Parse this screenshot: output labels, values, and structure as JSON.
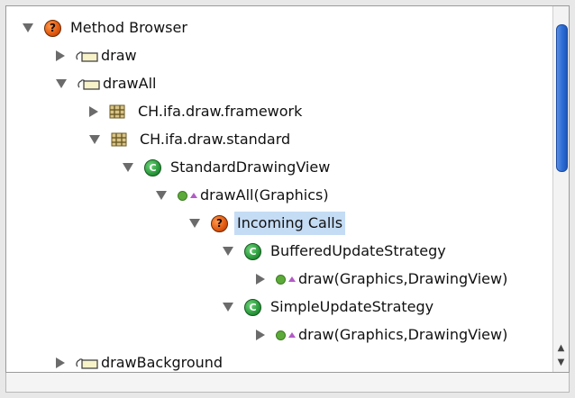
{
  "tree": {
    "root": {
      "label": "Method Browser",
      "icon": "question-icon"
    },
    "n_draw": {
      "label": "draw",
      "icon": "method-selector-icon"
    },
    "n_drawAll": {
      "label": "drawAll",
      "icon": "method-selector-icon"
    },
    "n_pkg_framework": {
      "label": "CH.ifa.draw.framework",
      "icon": "package-icon"
    },
    "n_pkg_standard": {
      "label": "CH.ifa.draw.standard",
      "icon": "package-icon"
    },
    "n_class_sdv": {
      "label": "StandardDrawingView",
      "icon": "class-icon",
      "glyph": "C"
    },
    "n_method_drawAll": {
      "label": "drawAll(Graphics)",
      "icon": "method-icon"
    },
    "n_incoming": {
      "label": "Incoming Calls",
      "icon": "question-icon",
      "glyph": "?"
    },
    "n_class_bus": {
      "label": "BufferedUpdateStrategy",
      "icon": "class-icon",
      "glyph": "C"
    },
    "n_method_draw1": {
      "label": "draw(Graphics,DrawingView)",
      "icon": "method-icon"
    },
    "n_class_sus": {
      "label": "SimpleUpdateStrategy",
      "icon": "class-icon",
      "glyph": "C"
    },
    "n_method_draw2": {
      "label": "draw(Graphics,DrawingView)",
      "icon": "method-icon"
    },
    "n_drawBackground": {
      "label": "drawBackground",
      "icon": "method-selector-icon"
    }
  },
  "glyphs": {
    "question": "?",
    "class": "C",
    "up": "▲",
    "down": "▼"
  },
  "colors": {
    "selection": "#c5dcf5",
    "class_icon": "#2a9a3c",
    "question_icon": "#e0570e",
    "scroll_thumb": "#2f6fd9"
  }
}
